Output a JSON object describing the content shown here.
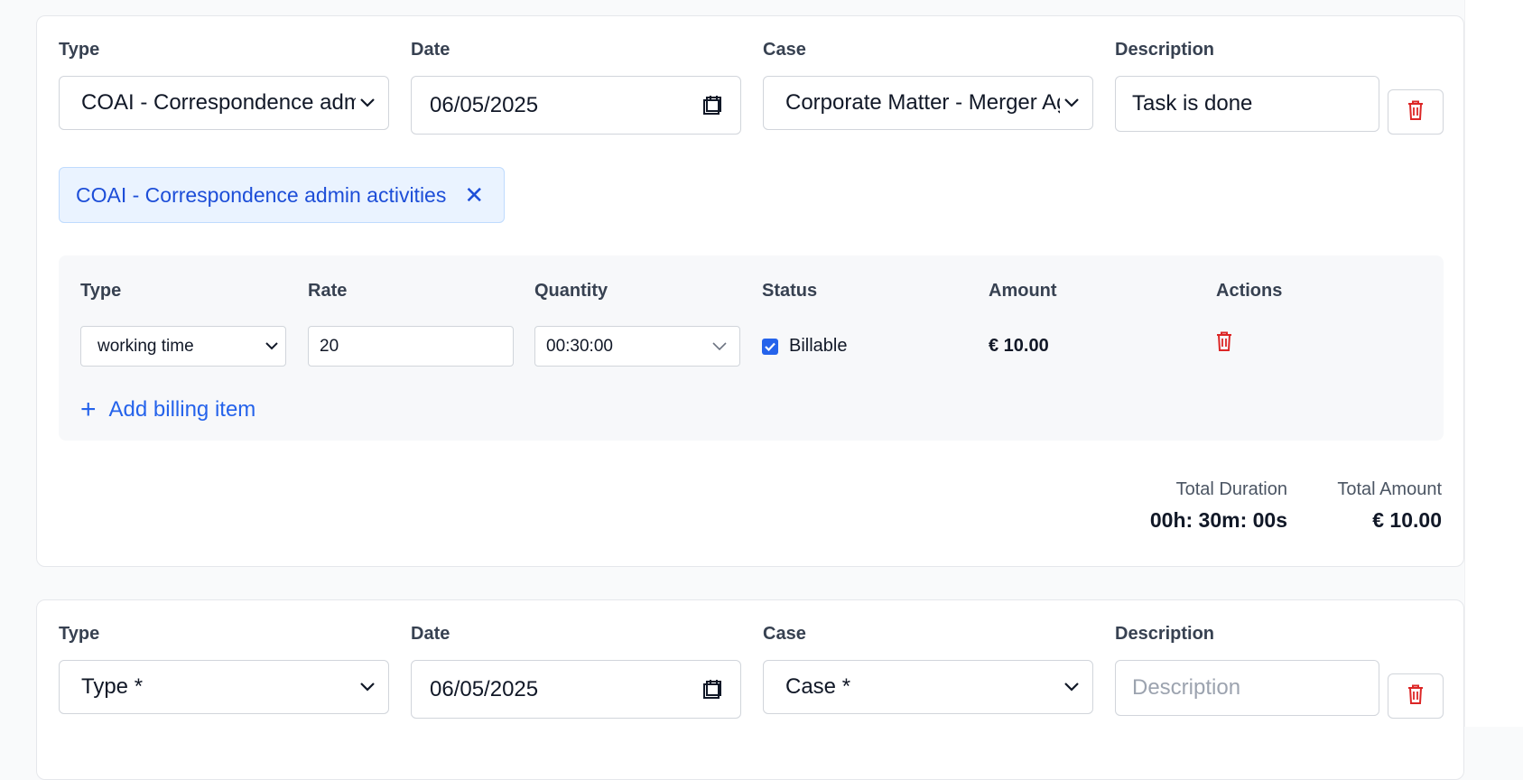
{
  "entries": [
    {
      "labels": {
        "type": "Type",
        "date": "Date",
        "case": "Case",
        "description": "Description"
      },
      "type_value": "COAI - Correspondence admin activities",
      "date_value": "06/05/2025",
      "case_value": "Corporate Matter - Merger Agreement",
      "description_value": "Task is done",
      "chip_label": "COAI - Correspondence admin activities",
      "chip_remove": "✕",
      "billing": {
        "headers": {
          "type": "Type",
          "rate": "Rate",
          "quantity": "Quantity",
          "status": "Status",
          "amount": "Amount",
          "actions": "Actions"
        },
        "items": [
          {
            "type": "working time",
            "rate": "20",
            "quantity": "00:30:00",
            "status": "Billable",
            "billable": true,
            "amount": "€ 10.00"
          }
        ],
        "add_label": "Add billing item"
      },
      "totals": {
        "duration_label": "Total Duration",
        "duration_value": "00h: 30m: 00s",
        "amount_label": "Total Amount",
        "amount_value": "€ 10.00"
      }
    },
    {
      "labels": {
        "type": "Type",
        "date": "Date",
        "case": "Case",
        "description": "Description"
      },
      "type_value": "Type *",
      "date_value": "06/05/2025",
      "case_value": "Case *",
      "description_placeholder": "Description"
    }
  ],
  "colors": {
    "accent": "#2563eb",
    "danger": "#dc2626",
    "chip_bg": "#eaf3ff"
  }
}
